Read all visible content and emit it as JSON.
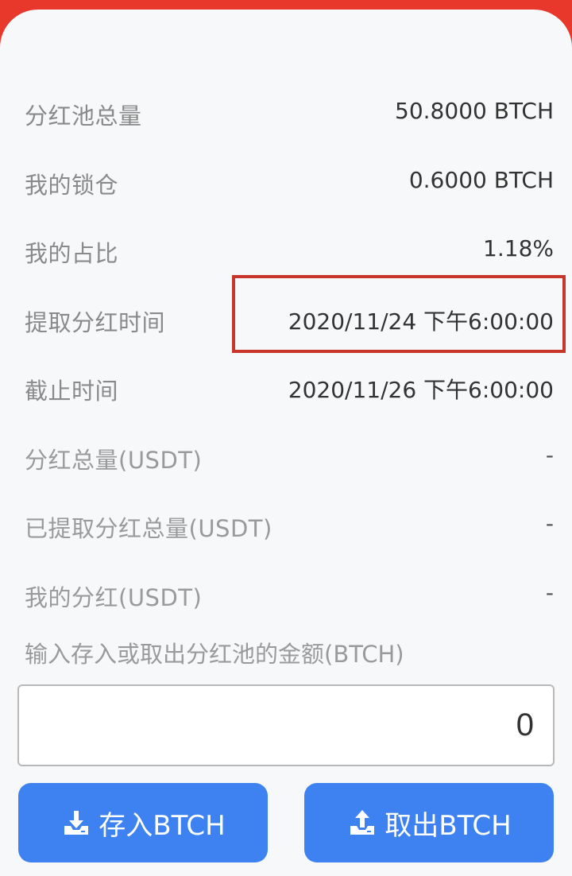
{
  "rows": [
    {
      "label": "分红池总量",
      "value": "50.8000 BTCH"
    },
    {
      "label": "我的锁仓",
      "value": "0.6000 BTCH"
    },
    {
      "label": "我的占比",
      "value": "1.18%"
    },
    {
      "label": "提取分红时间",
      "value": "2020/11/24 下午6:00:00"
    },
    {
      "label": "截止时间",
      "value": "2020/11/26 下午6:00:00"
    },
    {
      "label": "分红总量(USDT)",
      "value": "-"
    },
    {
      "label": "已提取分红总量(USDT)",
      "value": "-"
    },
    {
      "label": "我的分红(USDT)",
      "value": "-"
    }
  ],
  "amount": {
    "label": "输入存入或取出分红池的金额(BTCH)",
    "value": "0"
  },
  "buttons": {
    "deposit_label": "存入BTCH",
    "deposit_icon": "download-tray-icon",
    "withdraw_label": "取出BTCH",
    "withdraw_icon": "upload-tray-icon"
  },
  "colors": {
    "header_red": "#e8382b",
    "highlight_box": "#c8352b",
    "button_blue": "#3d82f0",
    "background": "#f7f8fa"
  }
}
